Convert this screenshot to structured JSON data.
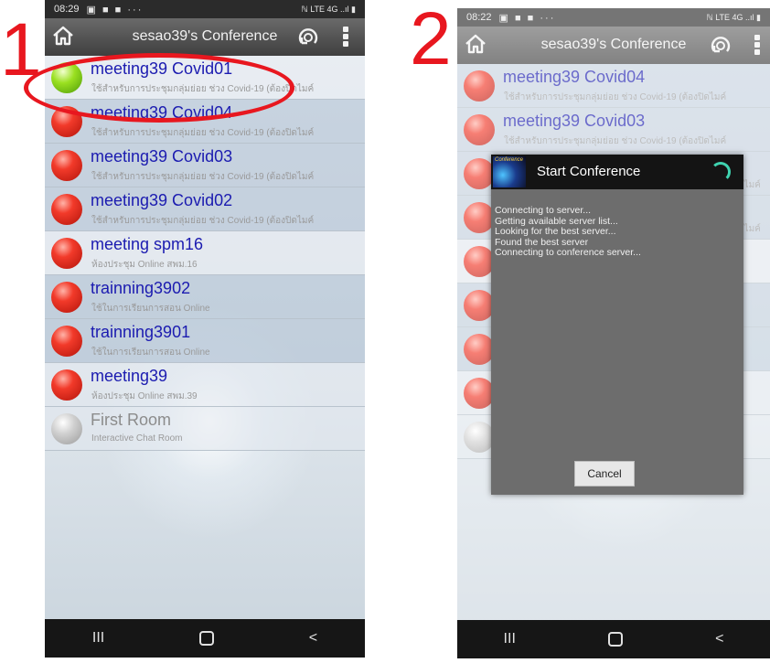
{
  "step_labels": [
    "1",
    "2"
  ],
  "panel1": {
    "status": {
      "time": "08:29",
      "notif_icons": "▣ ■ ■ ···",
      "right": "ℕ LTE 4G ..ıl ▮"
    },
    "toolbar": {
      "title": "sesao39's Conference"
    },
    "rooms": [
      {
        "name": "meeting39 Covid01",
        "desc": "ใช้สำหรับการประชุมกลุ่มย่อย ช่วง Covid-19 (ต้องปิดไมค์",
        "status": "green",
        "highlighted": true
      },
      {
        "name": "meeting39 Covid04",
        "desc": "ใช้สำหรับการประชุมกลุ่มย่อย ช่วง Covid-19 (ต้องปิดไมค์",
        "status": "red"
      },
      {
        "name": "meeting39 Covid03",
        "desc": "ใช้สำหรับการประชุมกลุ่มย่อย ช่วง Covid-19 (ต้องปิดไมค์",
        "status": "red"
      },
      {
        "name": "meeting39 Covid02",
        "desc": "ใช้สำหรับการประชุมกลุ่มย่อย ช่วง Covid-19 (ต้องปิดไมค์",
        "status": "red"
      },
      {
        "name": "meeting spm16",
        "desc": "ห้องประชุม Online สพม.16",
        "status": "red"
      },
      {
        "name": "trainning3902",
        "desc": "ใช้ในการเรียนการสอน Online",
        "status": "red"
      },
      {
        "name": "trainning3901",
        "desc": "ใช้ในการเรียนการสอน Online",
        "status": "red"
      },
      {
        "name": "meeting39",
        "desc": "ห้องประชุม Online สพม.39",
        "status": "red"
      },
      {
        "name": "First Room",
        "desc": "Interactive Chat Room",
        "status": "gray"
      }
    ],
    "navbar": {
      "recents": "III",
      "back": "<"
    }
  },
  "panel2": {
    "status": {
      "time": "08:22",
      "notif_icons": "▣ ■ ■ ···",
      "right": "ℕ LTE 4G ..ıl ▮"
    },
    "toolbar": {
      "title": "sesao39's Conference"
    },
    "rooms": [
      {
        "name": "meeting39 Covid04",
        "desc": "ใช้สำหรับการประชุมกลุ่มย่อย ช่วง Covid-19 (ต้องปิดไมค์",
        "status": "red"
      },
      {
        "name": "meeting39 Covid03",
        "desc": "ใช้สำหรับการประชุมกลุ่มย่อย ช่วง Covid-19 (ต้องปิดไมค์",
        "status": "red"
      },
      {
        "name": "",
        "desc": "(ต้องปิดไมค์",
        "status": "red"
      },
      {
        "name": "",
        "desc": "(ต้องปิดไมค์",
        "status": "red"
      },
      {
        "name": "",
        "desc": "",
        "status": "red"
      },
      {
        "name": "",
        "desc": "",
        "status": "red"
      },
      {
        "name": "",
        "desc": "",
        "status": "red"
      },
      {
        "name": "",
        "desc": "",
        "status": "red"
      },
      {
        "name": "",
        "desc": "",
        "status": "gray"
      }
    ],
    "dialog": {
      "logo_text": "Conference",
      "title": "Start Conference",
      "log": [
        "Connecting to server...",
        "Getting available server list...",
        "Looking for the best server...",
        "Found the best server",
        "Connecting to conference server..."
      ],
      "cancel_label": "Cancel"
    },
    "navbar": {
      "recents": "III",
      "back": "<"
    }
  },
  "colors": {
    "highlight": "#e8171f",
    "title_text": "#1b1bb0",
    "accent_spinner": "#3fd3b0"
  },
  "icons": [
    "home-icon",
    "refresh-icon",
    "more-vert-icon",
    "recents-icon",
    "home-nav-icon",
    "back-icon",
    "spinner-icon"
  ]
}
